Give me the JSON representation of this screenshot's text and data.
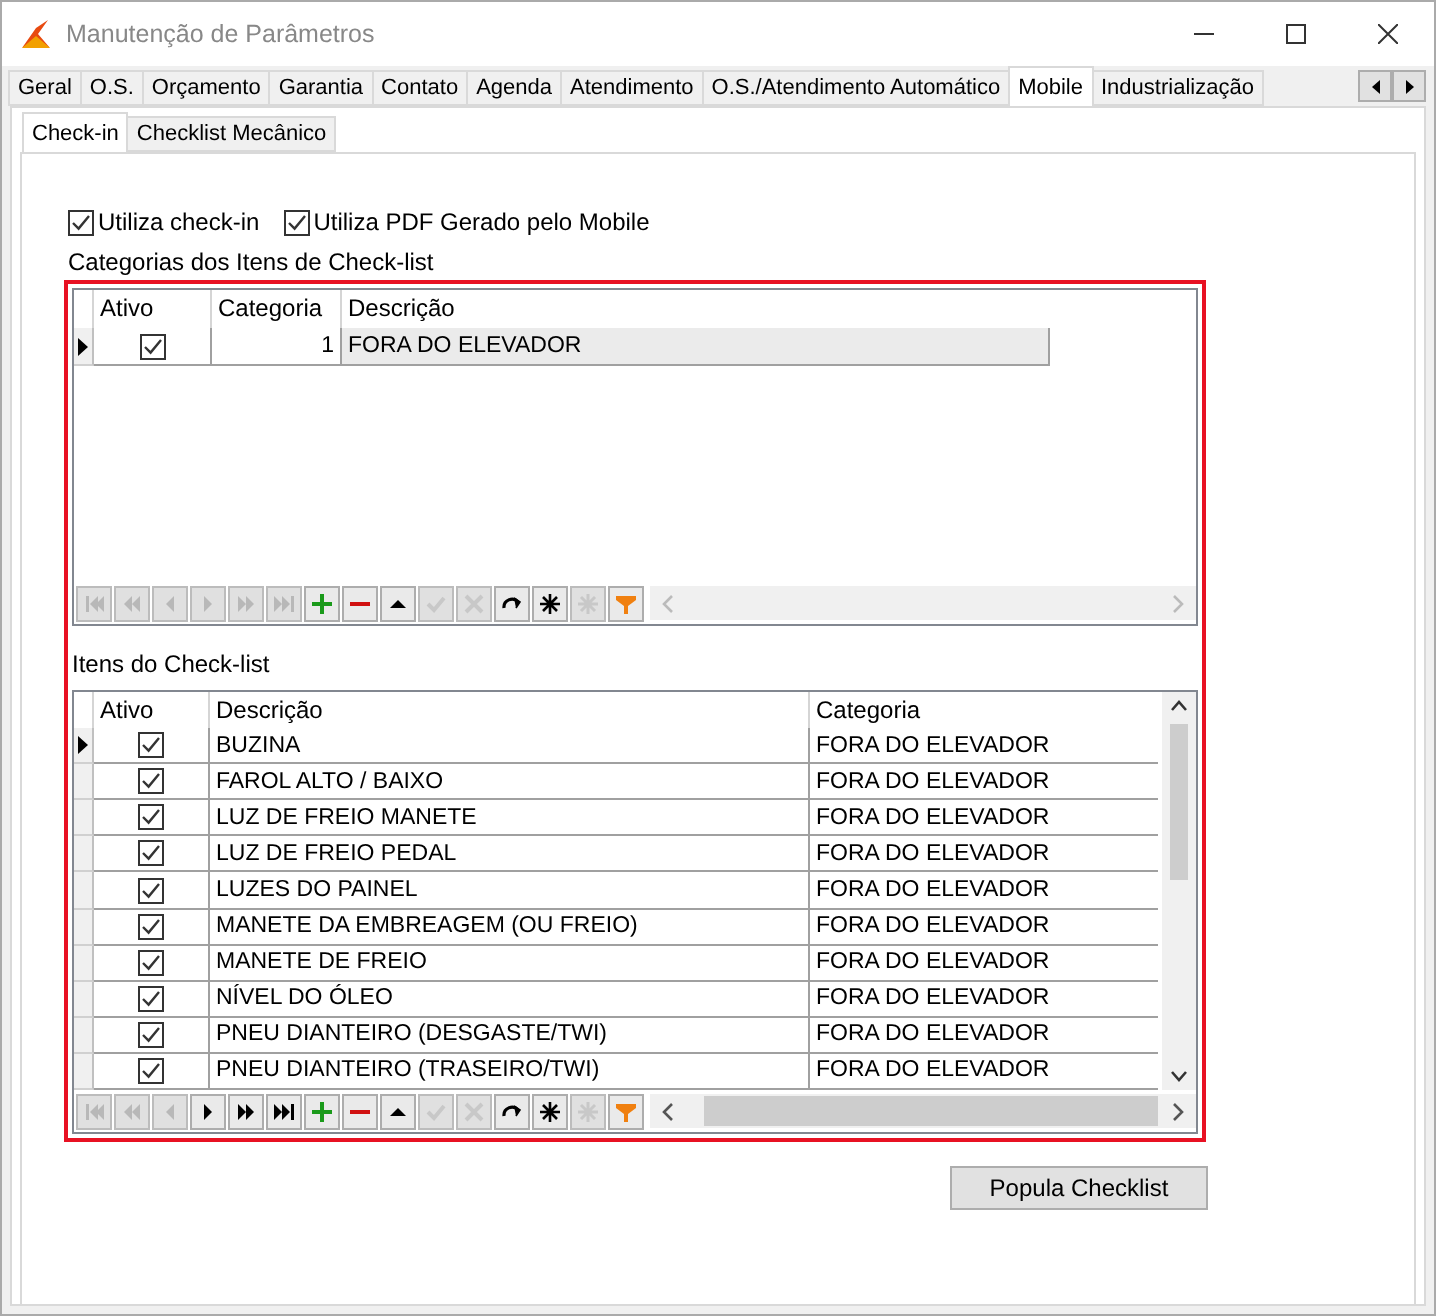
{
  "window": {
    "title": "Manutenção de Parâmetros"
  },
  "tabs": [
    {
      "label": "Geral",
      "selected": false
    },
    {
      "label": "O.S.",
      "selected": false
    },
    {
      "label": "Orçamento",
      "selected": false
    },
    {
      "label": "Garantia",
      "selected": false
    },
    {
      "label": "Contato",
      "selected": false
    },
    {
      "label": "Agenda",
      "selected": false
    },
    {
      "label": "Atendimento",
      "selected": false
    },
    {
      "label": "O.S./Atendimento Automático",
      "selected": false
    },
    {
      "label": "Mobile",
      "selected": true
    },
    {
      "label": "Industrialização",
      "selected": false
    }
  ],
  "subtabs": [
    {
      "label": "Check-in",
      "selected": true
    },
    {
      "label": "Checklist Mecânico",
      "selected": false
    }
  ],
  "options": [
    {
      "label": "Utiliza check-in",
      "checked": true
    },
    {
      "label": "Utiliza PDF Gerado pelo Mobile",
      "checked": true
    }
  ],
  "categories": {
    "label": "Categorias dos Itens de Check-list",
    "columns": [
      "Ativo",
      "Categoria",
      "Descrição"
    ],
    "rows": [
      {
        "selected": true,
        "active": true,
        "category": "1",
        "description": "FORA DO ELEVADOR"
      }
    ],
    "navigator": [
      {
        "kind": "first",
        "disabled": true
      },
      {
        "kind": "prior_page",
        "disabled": true
      },
      {
        "kind": "prior",
        "disabled": true
      },
      {
        "kind": "next",
        "disabled": true
      },
      {
        "kind": "next_page",
        "disabled": true
      },
      {
        "kind": "last",
        "disabled": true
      },
      {
        "kind": "insert",
        "disabled": false
      },
      {
        "kind": "delete",
        "disabled": false
      },
      {
        "kind": "edit",
        "disabled": false
      },
      {
        "kind": "post",
        "disabled": true
      },
      {
        "kind": "cancel",
        "disabled": true
      },
      {
        "kind": "refresh",
        "disabled": false
      },
      {
        "kind": "apply",
        "disabled": false
      },
      {
        "kind": "cancel_updates",
        "disabled": true
      },
      {
        "kind": "filter",
        "disabled": false
      }
    ]
  },
  "items": {
    "label": "Itens do Check-list",
    "columns": [
      "Ativo",
      "Descrição",
      "Categoria"
    ],
    "rows": [
      {
        "selected": true,
        "active": true,
        "description": "BUZINA",
        "category": "FORA DO ELEVADOR"
      },
      {
        "selected": false,
        "active": true,
        "description": "FAROL ALTO / BAIXO",
        "category": "FORA DO ELEVADOR"
      },
      {
        "selected": false,
        "active": true,
        "description": "LUZ DE FREIO MANETE",
        "category": "FORA DO ELEVADOR"
      },
      {
        "selected": false,
        "active": true,
        "description": "LUZ DE FREIO PEDAL",
        "category": "FORA DO ELEVADOR"
      },
      {
        "selected": false,
        "active": true,
        "description": "LUZES DO PAINEL",
        "category": "FORA DO ELEVADOR"
      },
      {
        "selected": false,
        "active": true,
        "description": "MANETE DA EMBREAGEM (OU FREIO)",
        "category": "FORA DO ELEVADOR"
      },
      {
        "selected": false,
        "active": true,
        "description": "MANETE DE FREIO",
        "category": "FORA DO ELEVADOR"
      },
      {
        "selected": false,
        "active": true,
        "description": "NÍVEL DO ÓLEO",
        "category": "FORA DO ELEVADOR"
      },
      {
        "selected": false,
        "active": true,
        "description": "PNEU DIANTEIRO (DESGASTE/TWI)",
        "category": "FORA DO ELEVADOR"
      },
      {
        "selected": false,
        "active": true,
        "description": "PNEU DIANTEIRO (TRASEIRO/TWI)",
        "category": "FORA DO ELEVADOR"
      }
    ],
    "navigator": [
      {
        "kind": "first",
        "disabled": true
      },
      {
        "kind": "prior_page",
        "disabled": true
      },
      {
        "kind": "prior",
        "disabled": true
      },
      {
        "kind": "next",
        "disabled": false
      },
      {
        "kind": "next_page",
        "disabled": false
      },
      {
        "kind": "last",
        "disabled": false
      },
      {
        "kind": "insert",
        "disabled": false
      },
      {
        "kind": "delete",
        "disabled": false
      },
      {
        "kind": "edit",
        "disabled": false
      },
      {
        "kind": "post",
        "disabled": true
      },
      {
        "kind": "cancel",
        "disabled": true
      },
      {
        "kind": "refresh",
        "disabled": false
      },
      {
        "kind": "apply",
        "disabled": false
      },
      {
        "kind": "cancel_updates",
        "disabled": true
      },
      {
        "kind": "filter",
        "disabled": false
      }
    ]
  },
  "button": {
    "label": "Popula Checklist"
  }
}
